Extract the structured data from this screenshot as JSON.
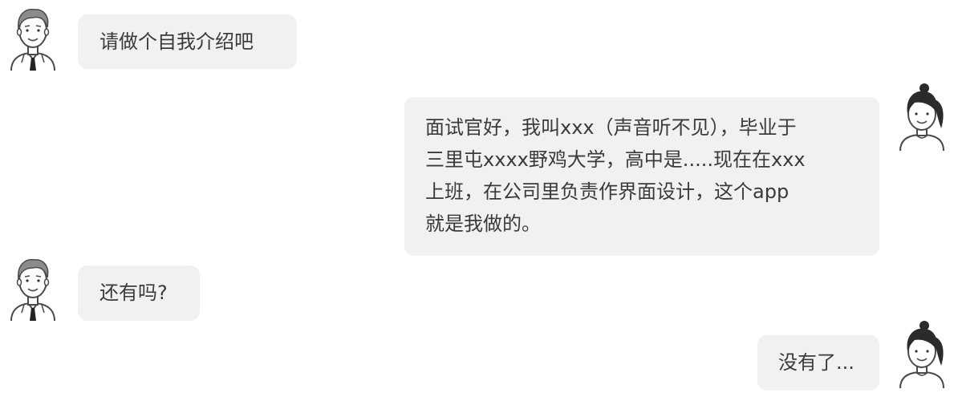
{
  "conversation": {
    "messages": [
      {
        "sender": "interviewer",
        "avatar_icon": "man-avatar-icon",
        "lines": [
          "请做个自我介绍吧"
        ]
      },
      {
        "sender": "candidate",
        "avatar_icon": "woman-avatar-icon",
        "lines": [
          "面试官好，我叫xxx（声音听不见），毕业于",
          "三里屯xxxx野鸡大学，高中是.....现在在xxx",
          "上班，在公司里负责作界面设计，这个app",
          "就是我做的。"
        ]
      },
      {
        "sender": "interviewer",
        "avatar_icon": "man-avatar-icon",
        "lines": [
          "还有吗?"
        ]
      },
      {
        "sender": "candidate",
        "avatar_icon": "woman-avatar-icon",
        "lines": [
          "没有了..."
        ]
      }
    ]
  },
  "colors": {
    "bubble_bg": "#f1f1f3",
    "text": "#3a3a3a",
    "avatar_stroke": "#4a4a4a",
    "hair_dark": "#2b2b2b",
    "hair_gray": "#8c8c8c"
  }
}
